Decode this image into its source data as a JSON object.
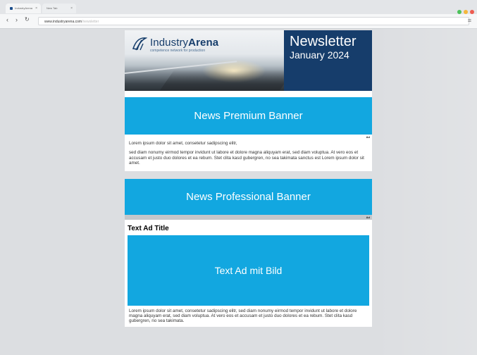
{
  "browser": {
    "tabs": [
      {
        "label": "IndustryArena"
      },
      {
        "label": "New Tab"
      }
    ],
    "tab_close_glyph": "×",
    "url_bold": "www.industryarena.com",
    "url_rest": "/newsletter",
    "nav": {
      "back": "‹",
      "forward": "›",
      "reload": "↻"
    },
    "menu_glyph": "≡",
    "window_dots": [
      "#4cc25a",
      "#f5b73b",
      "#ee5c50"
    ]
  },
  "header": {
    "brand_plain": "Industry",
    "brand_bold": "Arena",
    "tagline": "competence network for production",
    "newsletter_title": "Newsletter",
    "newsletter_date": "January 2024",
    "brand_color": "#163d6b"
  },
  "premium_banner": {
    "label": "News Premium Banner",
    "ad_label": "Ad",
    "color": "#12a7e0"
  },
  "intro_text": {
    "p1": "Lorem ipsum dolor sit amet, consetetur sadipscing elitr,",
    "p2": "sed diam nonumy eirmod tempor invidunt ut labore et dolore magna aliquyam erat, sed diam voluptua. At vero eos et accusam et justo duo dolores et ea rebum. Stet clita kasd gubergren, no sea takimata sanctus est Lorem ipsum dolor sit amet."
  },
  "professional_banner": {
    "label": "News Professional Banner",
    "ad_label": "Ad"
  },
  "text_ad": {
    "title": "Text Ad Title",
    "image_label": "Text Ad mit Bild",
    "body": "Lorem ipsum dolor sit amet, consetetur sadipscing elitr, sed diam nonumy eirmod tempor invidunt ut labore et dolore magna aliquyam erat, sed diam voluptua. At vero eos et accusam et justo duo dolores et ea rebum. Stet clita kasd gubergren, no sea takimata."
  }
}
